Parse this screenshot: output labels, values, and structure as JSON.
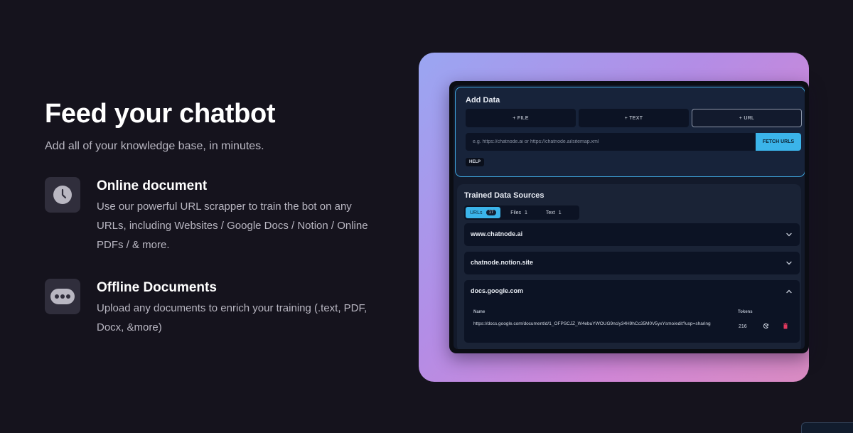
{
  "hero": {
    "title": "Feed your chatbot",
    "subtitle": "Add all of your knowledge base, in minutes."
  },
  "features": [
    {
      "icon": "clock-icon",
      "title": "Online document",
      "description": "Use our powerful URL scrapper to train the bot on any URLs, including Websites / Google Docs / Notion / Online PDFs / & more."
    },
    {
      "icon": "ellipsis-icon",
      "title": "Offline Documents",
      "description": "Upload any documents to enrich your training (.text, PDF, Docx, &more)"
    }
  ],
  "mockup": {
    "add_data": {
      "heading": "Add Data",
      "buttons": {
        "file": "+ FILE",
        "text": "+ TEXT",
        "url": "+ URL"
      },
      "url_placeholder": "e.g. https://chatnode.ai or https://chatnode.ai/sitemap.xml",
      "fetch_label": "FETCH URLS",
      "help_label": "HELP"
    },
    "trained": {
      "heading": "Trained Data Sources",
      "tabs": [
        {
          "label": "URLs",
          "count": "17",
          "active": true
        },
        {
          "label": "Files",
          "count": "1",
          "active": false
        },
        {
          "label": "Text",
          "count": "1",
          "active": false
        }
      ],
      "sources": [
        {
          "domain": "www.chatnode.ai",
          "expanded": false
        },
        {
          "domain": "chatnode.notion.site",
          "expanded": false
        },
        {
          "domain": "docs.google.com",
          "expanded": true
        }
      ],
      "table": {
        "name_header": "Name",
        "tokens_header": "Tokens",
        "row": {
          "url": "https://docs.google.com/document/d/1_OFPSCJZ_W4ebuYWOUG9ncly34H9hCc35M0V5yxYsmo/edit?usp=sharing",
          "tokens": "216"
        }
      }
    }
  },
  "colors": {
    "background": "#15131d",
    "accent": "#3bb4ea",
    "frame_gradient": [
      "#9aa6f2",
      "#b38de6",
      "#d98bc2"
    ],
    "delete": "#e0395e"
  }
}
